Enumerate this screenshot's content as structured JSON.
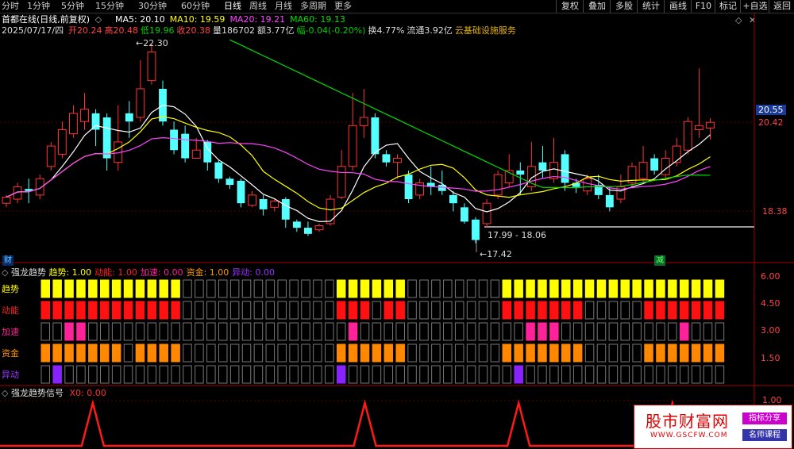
{
  "toolbar": {
    "timeframes": [
      "分时",
      "1分钟",
      "5分钟",
      "15分钟",
      "30分钟",
      "60分钟",
      "日线",
      "周线",
      "月线",
      "多周期",
      "更多"
    ],
    "active_timeframe": "日线",
    "buttons": [
      "复权",
      "叠加",
      "多股",
      "统计",
      "画线",
      "F10",
      "标记",
      "+自选",
      "返回"
    ]
  },
  "header": {
    "title": "首都在线(日线,前复权)",
    "ma": [
      {
        "label": "MA5: 20.10",
        "color": "#ffffff"
      },
      {
        "label": "MA10: 19.59",
        "color": "#ffff00"
      },
      {
        "label": "MA20: 19.21",
        "color": "#ff44ff"
      },
      {
        "label": "MA60: 19.13",
        "color": "#00dd00"
      }
    ],
    "date": "2025/07/17/四",
    "quote": [
      {
        "label": "开20.24",
        "color": "#ff4444"
      },
      {
        "label": "高20.48",
        "color": "#ff4444"
      },
      {
        "label": "低19.96",
        "color": "#00cc00"
      },
      {
        "label": "收20.38",
        "color": "#ff4444"
      },
      {
        "label": "量186702",
        "color": "#dddddd"
      },
      {
        "label": "额3.77亿",
        "color": "#dddddd"
      },
      {
        "label": "幅-0.04(-0.20%)",
        "color": "#00cc00"
      },
      {
        "label": "换4.77%",
        "color": "#dddddd"
      },
      {
        "label": "流通3.92亿",
        "color": "#dddddd"
      },
      {
        "label": "云基础设施服务",
        "color": "#e8b400"
      }
    ]
  },
  "price_axis": {
    "high_label": "20.55",
    "mid_label": "20.42",
    "low_label": "18.38"
  },
  "annotations": {
    "high": "22.30",
    "low": "17.42",
    "range": "17.99 - 18.06",
    "mark_left": "财",
    "mark_right": "减"
  },
  "indicator1": {
    "title": "强龙趋势",
    "values": [
      {
        "label": "趋势: 1.00",
        "color": "#ffff00"
      },
      {
        "label": "动能: 1.00",
        "color": "#ff2222"
      },
      {
        "label": "加速: 0.00",
        "color": "#ff2299"
      },
      {
        "label": "资金: 1.00",
        "color": "#ff9900"
      },
      {
        "label": "异动: 0.00",
        "color": "#9933ff"
      }
    ],
    "row_labels": [
      {
        "label": "趋势",
        "color": "#ffff00"
      },
      {
        "label": "动能",
        "color": "#ff2222"
      },
      {
        "label": "加速",
        "color": "#ff2299"
      },
      {
        "label": "资金",
        "color": "#ff9900"
      },
      {
        "label": "异动",
        "color": "#9933ff"
      }
    ],
    "axis": [
      "6.00",
      "4.50",
      "3.00",
      "1.50"
    ],
    "rows": {
      "trend": "1111111111110000000000000111111000000001111111111111111111",
      "energy": "1111111111110000000000000111011000000001111111000001111111",
      "accel": "0011000000000000000000000010000000000000011100000000001000",
      "fund": "1111111011110000000000000111111000000001111111000001111111",
      "anomaly": "0100000000000000000000000100000000000000100000000000000000"
    }
  },
  "indicator2": {
    "title": "强龙趋势信号",
    "value_label": "X0: 0.00",
    "axis_top": "1.00",
    "signals": [
      4,
      27,
      40,
      53
    ]
  },
  "stamp": {
    "brand": "股市财富网",
    "url": "WWW.GSCFW.COM",
    "tag1": "指标分享",
    "tag2": "名师课程"
  },
  "candles": [
    [
      18.4,
      18.55,
      18.3,
      18.6
    ],
    [
      18.5,
      18.8,
      18.4,
      18.9
    ],
    [
      18.75,
      18.7,
      18.4,
      19.0
    ],
    [
      18.6,
      19.0,
      18.5,
      19.1
    ],
    [
      19.3,
      19.8,
      19.2,
      19.9
    ],
    [
      19.6,
      20.2,
      19.5,
      20.4
    ],
    [
      20.1,
      20.6,
      20.0,
      20.8
    ],
    [
      20.4,
      20.7,
      20.2,
      21.1
    ],
    [
      20.6,
      20.2,
      19.8,
      20.7
    ],
    [
      20.5,
      19.5,
      19.2,
      20.6
    ],
    [
      19.4,
      19.9,
      19.2,
      20.8
    ],
    [
      20.6,
      20.4,
      20.0,
      20.9
    ],
    [
      20.5,
      21.2,
      20.4,
      21.9
    ],
    [
      21.4,
      22.1,
      21.3,
      22.3
    ],
    [
      21.2,
      20.4,
      20.3,
      21.4
    ],
    [
      20.2,
      19.7,
      19.6,
      20.4
    ],
    [
      20.1,
      19.5,
      19.4,
      20.3
    ],
    [
      19.5,
      19.7,
      19.5,
      20.0
    ],
    [
      19.9,
      19.4,
      19.2,
      19.95
    ],
    [
      19.4,
      19.0,
      18.9,
      19.45
    ],
    [
      19.0,
      18.85,
      18.75,
      19.05
    ],
    [
      18.95,
      18.4,
      18.3,
      19.0
    ],
    [
      18.35,
      18.6,
      18.3,
      18.7
    ],
    [
      18.5,
      18.25,
      18.1,
      18.6
    ],
    [
      18.3,
      18.45,
      18.2,
      18.5
    ],
    [
      18.5,
      18.0,
      17.8,
      18.55
    ],
    [
      17.95,
      17.8,
      17.7,
      18.0
    ],
    [
      17.8,
      17.65,
      17.6,
      17.95
    ],
    [
      17.75,
      17.85,
      17.7,
      17.9
    ],
    [
      17.9,
      18.5,
      17.85,
      18.6
    ],
    [
      18.55,
      19.3,
      18.5,
      19.7
    ],
    [
      19.3,
      20.3,
      19.2,
      21.1
    ],
    [
      20.3,
      20.5,
      20.0,
      21.2
    ],
    [
      20.5,
      19.6,
      19.5,
      20.6
    ],
    [
      19.6,
      19.4,
      19.3,
      19.7
    ],
    [
      19.4,
      19.5,
      19.0,
      19.6
    ],
    [
      19.1,
      18.5,
      18.4,
      19.2
    ],
    [
      18.6,
      18.9,
      18.5,
      19.0
    ],
    [
      18.9,
      18.8,
      18.6,
      19.3
    ],
    [
      18.85,
      18.7,
      18.6,
      19.2
    ],
    [
      18.6,
      18.4,
      18.2,
      18.7
    ],
    [
      18.3,
      17.95,
      17.9,
      18.4
    ],
    [
      18.0,
      17.5,
      17.42,
      18.06
    ],
    [
      17.9,
      18.4,
      17.8,
      18.5
    ],
    [
      18.6,
      19.1,
      18.5,
      19.2
    ],
    [
      18.9,
      19.2,
      18.8,
      19.6
    ],
    [
      19.2,
      19.1,
      18.6,
      19.4
    ],
    [
      18.8,
      19.3,
      18.7,
      19.9
    ],
    [
      19.4,
      19.2,
      19.0,
      19.8
    ],
    [
      19.0,
      19.4,
      18.9,
      20.0
    ],
    [
      19.6,
      18.9,
      18.7,
      19.7
    ],
    [
      18.9,
      18.8,
      18.65,
      19.0
    ],
    [
      18.7,
      19.0,
      18.6,
      19.1
    ],
    [
      18.85,
      18.6,
      18.5,
      19.1
    ],
    [
      18.6,
      18.3,
      18.2,
      18.8
    ],
    [
      18.5,
      18.8,
      18.4,
      19.1
    ],
    [
      18.9,
      19.3,
      18.8,
      19.4
    ],
    [
      19.0,
      19.4,
      18.9,
      19.8
    ],
    [
      19.5,
      19.2,
      19.1,
      19.6
    ],
    [
      19.1,
      19.5,
      19.0,
      19.7
    ],
    [
      19.4,
      19.8,
      19.3,
      20.0
    ],
    [
      19.7,
      20.4,
      19.6,
      20.5
    ],
    [
      20.2,
      20.3,
      20.0,
      21.7
    ],
    [
      20.24,
      20.38,
      19.96,
      20.48
    ]
  ],
  "ma_lines": {
    "ma5": "#ffffff",
    "ma10": "#ffff00",
    "ma20": "#ff44ff",
    "ma60": "#00dd00"
  }
}
